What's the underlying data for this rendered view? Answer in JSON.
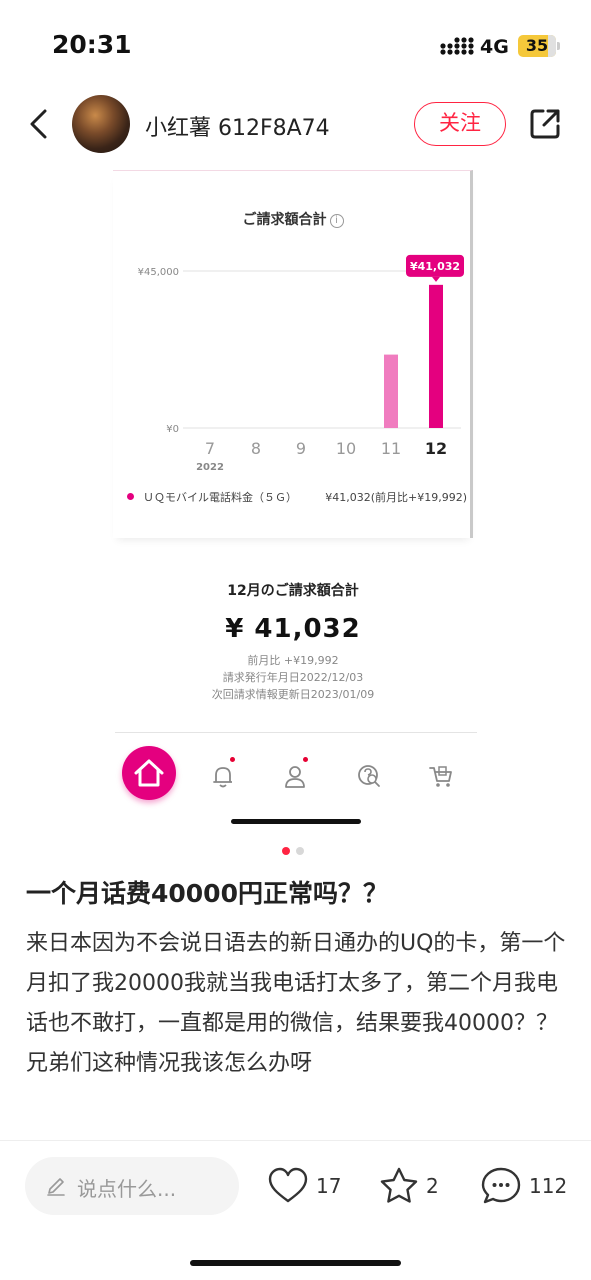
{
  "status_bar": {
    "time": "20:31",
    "network": "4G",
    "battery": "35"
  },
  "header": {
    "username": "小红薯 612F8A74",
    "follow_label": "关注"
  },
  "screenshot": {
    "chart_data": {
      "type": "bar",
      "title": "ご請求額合計",
      "categories": [
        "7",
        "8",
        "9",
        "10",
        "11",
        "12"
      ],
      "year_label": "2022",
      "series": [
        {
          "name": "UQモバイル電話料金（5G）",
          "values": [
            0,
            0,
            0,
            0,
            21040,
            41032
          ]
        }
      ],
      "y_ticks": [
        "¥45,000",
        "¥0"
      ],
      "ylim": [
        0,
        45000
      ],
      "highlight_label": "¥41,032",
      "colors": {
        "current": "#e4007f",
        "previous": "#f07cbf"
      },
      "legend_name": "ＵＱモバイル電話料金（５Ｇ）",
      "legend_value": "¥41,032(前月比+¥19,992)"
    },
    "summary": {
      "title": "12月のご請求額合計",
      "total": "¥ 41,032",
      "diff": "前月比 +¥19,992",
      "issue_date": "請求発行年月日2022/12/03",
      "next_update": "次回請求情報更新日2023/01/09"
    },
    "tabbar_icons": [
      "home-icon",
      "bell-icon",
      "person-icon",
      "help-search-icon",
      "cart-icon"
    ]
  },
  "pager": {
    "count": 2,
    "active": 0
  },
  "post": {
    "title": "一个月话费40000円正常吗？？",
    "body": "来日本因为不会说日语去的新日通办的UQ的卡，第一个月扣了我20000我就当我电话打太多了，第二个月我电话也不敢打，一直都是用的微信，结果要我40000？？兄弟们这种情况我该怎么办呀"
  },
  "bottom_bar": {
    "comment_placeholder": "说点什么...",
    "likes": "17",
    "collects": "2",
    "comments": "112"
  }
}
